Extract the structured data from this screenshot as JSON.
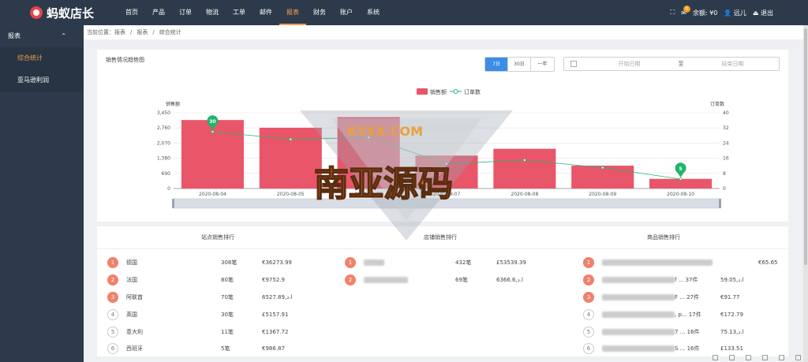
{
  "app": {
    "logo_text": "蚂蚁店长"
  },
  "nav": {
    "items": [
      "首页",
      "产品",
      "订单",
      "物流",
      "工单",
      "邮件",
      "报表",
      "财务",
      "账户",
      "系统"
    ],
    "active_index": 6
  },
  "topright": {
    "msg_badge": "0",
    "balance": "余额: ¥0",
    "user": "远儿",
    "logout": "退出"
  },
  "sidebar": {
    "group": "报表",
    "items": [
      {
        "label": "综合统计",
        "active": true
      },
      {
        "label": "亚马逊利润",
        "active": false
      }
    ]
  },
  "breadcrumb": {
    "parts": [
      "当前位置：报表",
      "/",
      "报表",
      "/",
      "综合统计"
    ]
  },
  "card1": {
    "title": "销售情况趋势图",
    "ranges": [
      "7日",
      "30日",
      "一年"
    ],
    "active_range": 0,
    "date_start_placeholder": "开始日期",
    "date_sep": "至",
    "date_end_placeholder": "结束日期"
  },
  "chart_data": {
    "type": "bar",
    "legend": [
      "销售额",
      "订单数"
    ],
    "ylabel_left": "销售额",
    "ylabel_right": "订单数",
    "categories": [
      "2020-08-04",
      "2020-08-05",
      "2020-08-06",
      "2020-08-07",
      "2020-08-08",
      "2020-08-09",
      "2020-08-10"
    ],
    "series": [
      {
        "name": "销售额",
        "type": "bar",
        "color": "#e9566a",
        "values": [
          3120,
          2770,
          3250,
          1500,
          1810,
          1040,
          440
        ]
      },
      {
        "name": "订单数",
        "type": "line",
        "color": "#22b573",
        "values": [
          30,
          26,
          27,
          13,
          15,
          11,
          5
        ]
      }
    ],
    "yticks_left": [
      "0",
      "690",
      "1,380",
      "2,070",
      "2,760",
      "3,450"
    ],
    "yticks_right": [
      "0",
      "8",
      "16",
      "24",
      "32",
      "40"
    ],
    "ylim_left": [
      0,
      3450
    ],
    "ylim_right": [
      0,
      40
    ],
    "markers": [
      {
        "index": 0,
        "label": "30"
      },
      {
        "index": 6,
        "label": "5"
      }
    ],
    "grid": true,
    "legend_position": "top-center"
  },
  "ranks": {
    "site": {
      "title": "站点销售排行",
      "rows": [
        {
          "rank": "1",
          "name": "德国",
          "count": "308笔",
          "amount": "€36273.99"
        },
        {
          "rank": "2",
          "name": "法国",
          "count": "80笔",
          "amount": "€9752.9"
        },
        {
          "rank": "3",
          "name": "阿联酋",
          "count": "70笔",
          "amount": "6527.89,ا.د"
        },
        {
          "rank": "4",
          "name": "英国",
          "count": "30笔",
          "amount": "£5157.91"
        },
        {
          "rank": "5",
          "name": "意大利",
          "count": "11笔",
          "amount": "€1367.72"
        },
        {
          "rank": "6",
          "name": "西班牙",
          "count": "5笔",
          "amount": "€986.87"
        }
      ]
    },
    "store": {
      "title": "店铺销售排行",
      "rows": [
        {
          "rank": "1",
          "count": "432笔",
          "amount": "£53539.39"
        },
        {
          "rank": "2",
          "count": "69笔",
          "amount": "6366.6,ا.د"
        }
      ]
    },
    "product": {
      "title": "商品销售排行",
      "rows": [
        {
          "rank": "1",
          "tail": "",
          "amount": "€65.65"
        },
        {
          "rank": "2",
          "tail": "f ... 37件",
          "amount": "59.05,ا.د"
        },
        {
          "rank": "3",
          "tail": "F ... 27件",
          "amount": "€91.77"
        },
        {
          "rank": "4",
          "tail": ", p... 17件",
          "amount": "€172.79"
        },
        {
          "rank": "5",
          "tail": "7 ... 16件",
          "amount": "75.13,ا.د"
        },
        {
          "rank": "6",
          "tail": "S ... 16件",
          "amount": "£133.51"
        }
      ]
    }
  },
  "watermark": {
    "text": "南亚源码",
    "subtext": "KYXX.COM"
  }
}
